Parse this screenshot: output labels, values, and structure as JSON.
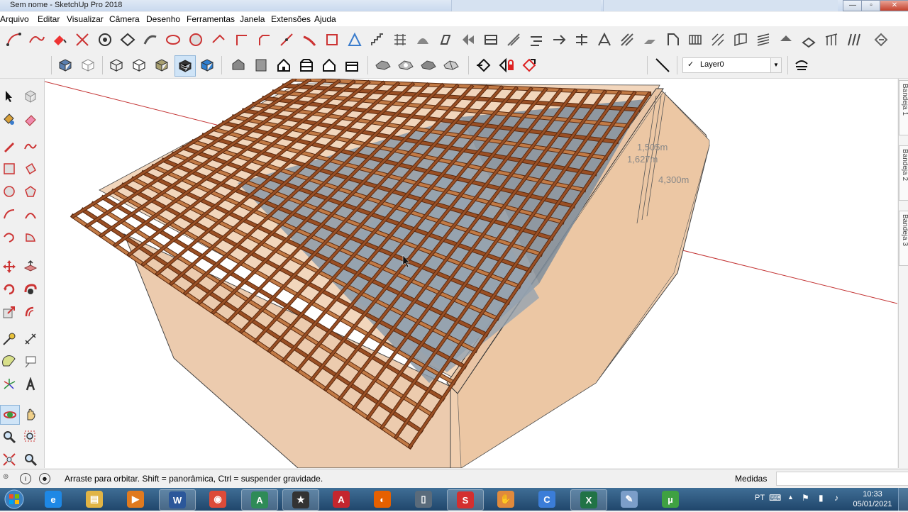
{
  "window": {
    "title": "Sem nome - SketchUp Pro 2018",
    "controls": {
      "minimize": "—",
      "maximize": "▫",
      "close": "✕"
    }
  },
  "menu": [
    "Arquivo",
    "Editar",
    "Visualizar",
    "Câmera",
    "Desenho",
    "Ferramentas",
    "Janela",
    "Extensões",
    "Ajuda"
  ],
  "layer": {
    "current": "Layer0",
    "check": "✓",
    "arrow": "▼"
  },
  "viewport": {
    "dimensions": [
      "1,505m",
      "1,627m",
      "4,300m"
    ]
  },
  "trays": [
    "Bandeja 1",
    "Bandeja 2",
    "Bandeja 3"
  ],
  "status": {
    "message": "Arraste para orbitar. Shift = panorâmica, Ctrl = suspender gravidade.",
    "measurements_label": "Medidas",
    "measurements_value": "",
    "info_icon": "i",
    "user_icon": "☻"
  },
  "taskbar": {
    "apps": [
      {
        "name": "internet-explorer",
        "glyph": "e",
        "color": "#1e88e5",
        "open": false
      },
      {
        "name": "file-explorer",
        "glyph": "▤",
        "color": "#e1b445",
        "open": false
      },
      {
        "name": "media-player",
        "glyph": "▶",
        "color": "#e07a1f",
        "open": false
      },
      {
        "name": "word",
        "glyph": "W",
        "color": "#2b579a",
        "open": true
      },
      {
        "name": "chrome",
        "glyph": "◉",
        "color": "#dd4b39",
        "open": false
      },
      {
        "name": "access",
        "glyph": "A",
        "color": "#2e8b57",
        "open": true
      },
      {
        "name": "movie-maker",
        "glyph": "★",
        "color": "#333333",
        "open": true
      },
      {
        "name": "autocad",
        "glyph": "A",
        "color": "#c4262e",
        "open": false
      },
      {
        "name": "firefox",
        "glyph": "◐",
        "color": "#e66000",
        "open": false
      },
      {
        "name": "device",
        "glyph": "▯",
        "color": "#5a6b7b",
        "open": false
      },
      {
        "name": "sketchup",
        "glyph": "S",
        "color": "#d32f2f",
        "open": true
      },
      {
        "name": "gimp",
        "glyph": "✋",
        "color": "#e08a3c",
        "open": false
      },
      {
        "name": "ccleaner",
        "glyph": "C",
        "color": "#3b7dd8",
        "open": false
      },
      {
        "name": "excel",
        "glyph": "X",
        "color": "#217346",
        "open": true
      },
      {
        "name": "paint",
        "glyph": "✎",
        "color": "#7b9ec9",
        "open": false
      },
      {
        "name": "utorrent",
        "glyph": "µ",
        "color": "#3fa142",
        "open": false
      }
    ],
    "lang": "PT",
    "time": "10:33",
    "date": "05/01/2021"
  },
  "colors": {
    "wood": "#9a4f24",
    "wood_light": "#c27a45",
    "wall": "#f0cfb0",
    "wall_dark": "#e2b996",
    "glass": "#8c9aa8",
    "axis_red": "#c33333"
  }
}
